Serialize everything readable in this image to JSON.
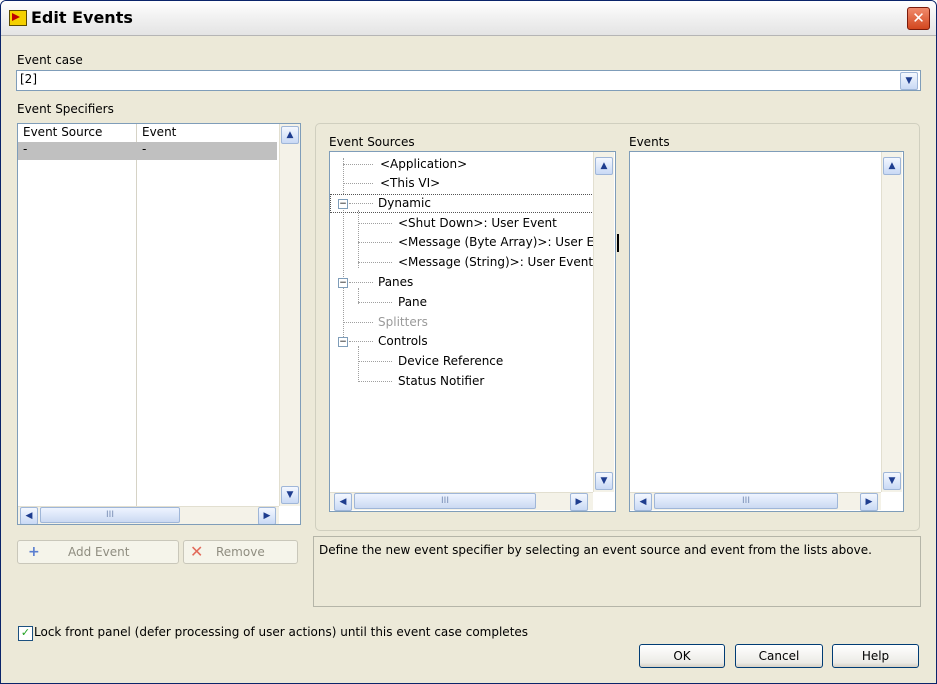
{
  "window": {
    "title": "Edit Events",
    "close_glyph": "✕"
  },
  "event_case": {
    "label": "Event case",
    "value": "[2]"
  },
  "event_specifiers": {
    "label": "Event Specifiers",
    "columns": [
      "Event Source",
      "Event"
    ],
    "rows": [
      {
        "source": "-",
        "event": "-"
      }
    ],
    "hscroll_thumb": "III"
  },
  "event_sources": {
    "label": "Event Sources",
    "items": [
      {
        "label": "<Application>",
        "level": 1,
        "expander": ""
      },
      {
        "label": "<This VI>",
        "level": 1,
        "expander": ""
      },
      {
        "label": "Dynamic",
        "level": 0,
        "expander": "⊟",
        "selected": true
      },
      {
        "label": "<Shut Down>: User Event",
        "level": 2,
        "expander": ""
      },
      {
        "label": "<Message (Byte Array)>: User E",
        "level": 2,
        "expander": ""
      },
      {
        "label": "<Message (String)>: User Event",
        "level": 2,
        "expander": ""
      },
      {
        "label": "Panes",
        "level": 0,
        "expander": "⊟"
      },
      {
        "label": "Pane",
        "level": 2,
        "expander": ""
      },
      {
        "label": "Splitters",
        "level": 0,
        "expander": "",
        "disabled": true
      },
      {
        "label": "Controls",
        "level": 0,
        "expander": "⊟"
      },
      {
        "label": "Device Reference",
        "level": 2,
        "expander": ""
      },
      {
        "label": "Status Notifier",
        "level": 2,
        "expander": ""
      }
    ],
    "hscroll_thumb": "III"
  },
  "events": {
    "label": "Events",
    "hscroll_thumb": "III"
  },
  "buttons": {
    "add_event": "Add Event",
    "remove": "Remove",
    "ok": "OK",
    "cancel": "Cancel",
    "help": "Help"
  },
  "description": "Define the new event specifier by selecting an event source and event from the lists above.",
  "lock_checkbox": {
    "label": "Lock front panel (defer processing of user actions) until this event case completes",
    "checked": true
  },
  "colors": {
    "selection": "#c0c0c0",
    "dialog_bg": "#ece9d8",
    "title_text": "#000000"
  }
}
